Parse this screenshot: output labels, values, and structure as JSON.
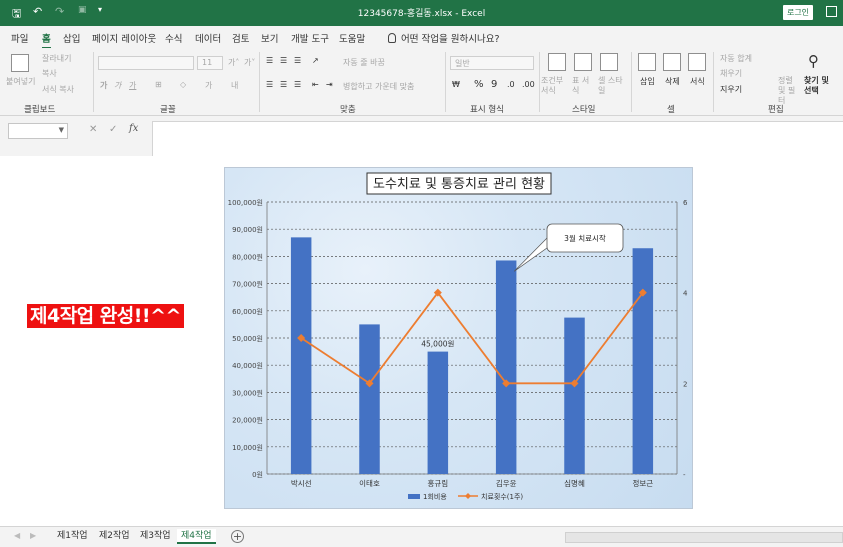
{
  "titlebar": {
    "doc_title": "12345678-홍길동.xlsx  -  Excel",
    "login": "로그인"
  },
  "tabs": [
    {
      "label": "파일"
    },
    {
      "label": "홈"
    },
    {
      "label": "삽입"
    },
    {
      "label": "페이지 레이아웃"
    },
    {
      "label": "수식"
    },
    {
      "label": "데이터"
    },
    {
      "label": "검토"
    },
    {
      "label": "보기"
    },
    {
      "label": "개발 도구"
    },
    {
      "label": "도움말"
    }
  ],
  "tell_me": "어떤 작업을 원하시나요?",
  "ribbon": {
    "clipboard": {
      "paste": "붙여넣기",
      "cut": "잘라내기",
      "copy": "복사",
      "format_painter": "서식 복사",
      "label": "클립보드"
    },
    "font": {
      "size": "11",
      "label": "글꼴"
    },
    "align": {
      "wrap": "자동 줄 바꿈",
      "merge": "병합하고 가운데 맞춤",
      "label": "맞춤"
    },
    "number": {
      "format": "일반",
      "label": "표시 형식"
    },
    "styles": {
      "conditional": "조건부 서식",
      "table": "표 서식",
      "cell": "셀 스타일",
      "label": "스타일"
    },
    "cells": {
      "insert": "삽입",
      "delete": "삭제",
      "format": "서식",
      "label": "셀"
    },
    "editing": {
      "autosum": "자동 합계",
      "fill": "채우기",
      "clear": "지우기",
      "sort": "정렬 및 필터",
      "find": "찾기 및 선택",
      "label": "편집"
    }
  },
  "formula": {
    "fx": "fx"
  },
  "message": "제4작업 완성!!^^",
  "sheets": [
    {
      "label": "제1작업"
    },
    {
      "label": "제2작업"
    },
    {
      "label": "제3작업"
    },
    {
      "label": "제4작업"
    }
  ],
  "chart_data": {
    "type": "bar",
    "title": "도수치료 및 통증치료 관리 현황",
    "categories": [
      "박시선",
      "이태호",
      "홍규림",
      "김우윤",
      "심명혜",
      "정보근"
    ],
    "series": [
      {
        "name": "1회비용",
        "type": "bar",
        "axis": "left",
        "color": "#4472c4",
        "values": [
          87000,
          55000,
          45000,
          78500,
          57500,
          83000
        ]
      },
      {
        "name": "치료횟수(1주)",
        "type": "line",
        "axis": "right",
        "color": "#ed7d31",
        "values": [
          3,
          2,
          4,
          2,
          2,
          4
        ]
      }
    ],
    "ylim": [
      0,
      100000
    ],
    "yticks": [
      "0원",
      "10,000원",
      "20,000원",
      "30,000원",
      "40,000원",
      "50,000원",
      "60,000원",
      "70,000원",
      "80,000원",
      "90,000원",
      "100,000원"
    ],
    "y2lim": [
      0,
      6
    ],
    "y2ticks": [
      "-",
      "2",
      "4",
      "6"
    ],
    "data_label": {
      "index": 2,
      "text": "45,000원"
    },
    "callout": "3월 치료시작",
    "grid": "dashed",
    "legend": "bottom"
  }
}
